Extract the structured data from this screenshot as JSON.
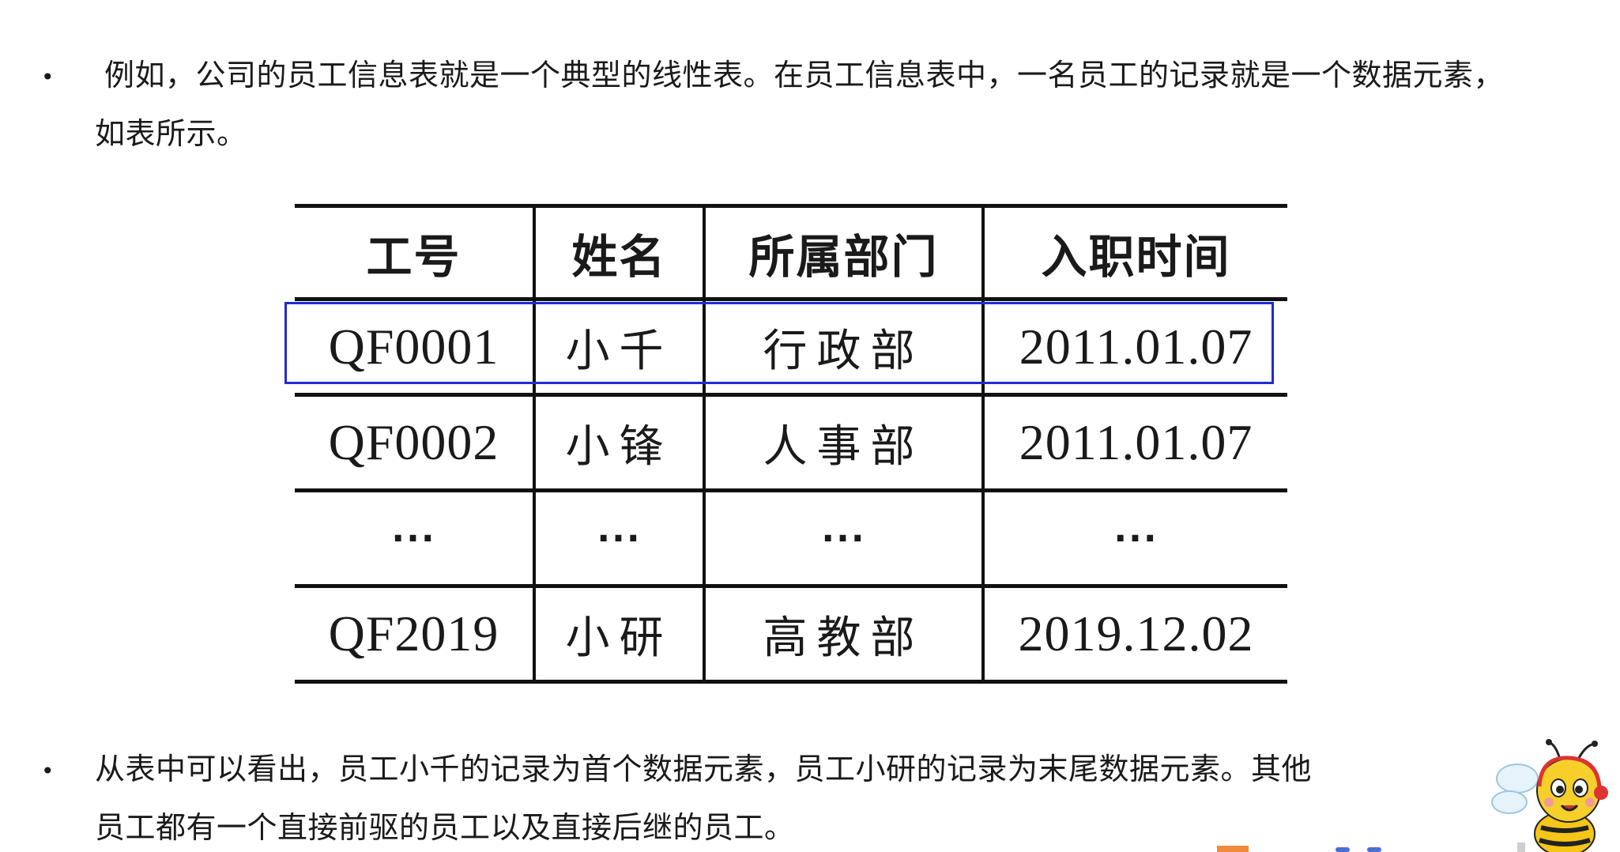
{
  "paragraph1": {
    "bullet": "•",
    "line1": "例如，公司的员工信息表就是一个典型的线性表。在员工信息表中，一名员工的记录就是一个数据元素，",
    "line2": "如表所示。"
  },
  "table": {
    "headers": [
      "工号",
      "姓名",
      "所属部门",
      "入职时间"
    ],
    "rows": [
      [
        "QF0001",
        "小千",
        "行政部",
        "2011.01.07"
      ],
      [
        "QF0002",
        "小锋",
        "人事部",
        "2011.01.07"
      ],
      [
        "···",
        "···",
        "···",
        "···"
      ],
      [
        "QF2019",
        "小研",
        "高教部",
        "2019.12.02"
      ]
    ],
    "highlighted_row": 0,
    "highlight_color": "#1f2bd1"
  },
  "paragraph2": {
    "bullet": "•",
    "line1": "从表中可以看出，员工小千的记录为首个数据元素，员工小研的记录为末尾数据元素。其他",
    "line2": "员工都有一个直接前驱的员工以及直接后继的员工。"
  },
  "mascot": {
    "icon": "bee-mascot-icon"
  }
}
